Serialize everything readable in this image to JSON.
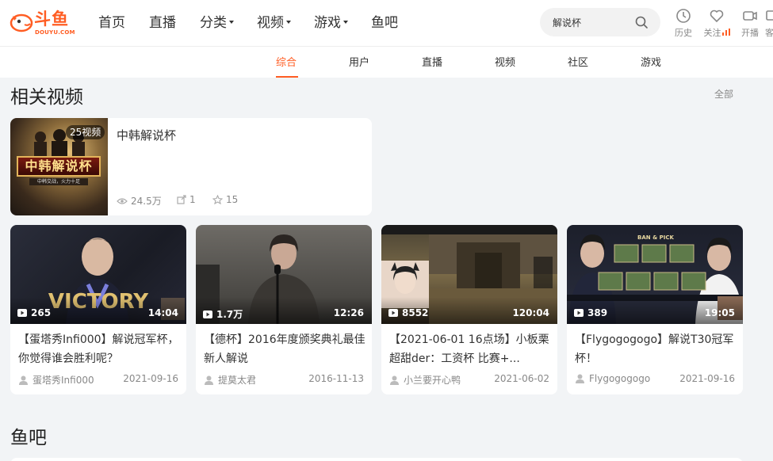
{
  "header": {
    "logo_text": "斗鱼",
    "logo_sub": "DOUYU.COM",
    "nav": [
      {
        "label": "首页",
        "dropdown": false
      },
      {
        "label": "直播",
        "dropdown": false
      },
      {
        "label": "分类",
        "dropdown": true
      },
      {
        "label": "视频",
        "dropdown": true
      },
      {
        "label": "游戏",
        "dropdown": true
      },
      {
        "label": "鱼吧",
        "dropdown": false
      }
    ],
    "search": {
      "value": "解说杯",
      "icon": "search-icon"
    },
    "tools": [
      {
        "label": "历史",
        "icon": "clock-icon"
      },
      {
        "label": "关注",
        "icon": "heart-icon"
      },
      {
        "label": "开播",
        "icon": "camera-icon"
      },
      {
        "label": "客",
        "icon": "client-icon"
      }
    ]
  },
  "tabs": [
    {
      "label": "综合",
      "active": true
    },
    {
      "label": "用户",
      "active": false
    },
    {
      "label": "直播",
      "active": false
    },
    {
      "label": "视频",
      "active": false
    },
    {
      "label": "社区",
      "active": false
    },
    {
      "label": "游戏",
      "active": false
    }
  ],
  "related": {
    "title": "相关视频",
    "all_label": "全部",
    "collection": {
      "badge": "25视频",
      "title": "中韩解说杯",
      "thumb_text": "中韩解说杯",
      "thumb_sub": "中韩交战，火力十足",
      "views": "24.5万",
      "shares": "1",
      "favorites": "15"
    },
    "videos": [
      {
        "plays": "265",
        "duration": "14:04",
        "title": "【蛋塔秀Infi000】解说冠军杯，你觉得谁会胜利呢？",
        "author": "蛋塔秀Infi000",
        "date": "2021-09-16",
        "thumb_text": "VICTORY"
      },
      {
        "plays": "1.7万",
        "duration": "12:26",
        "title": "【德杯】2016年度颁奖典礼最佳新人解说",
        "author": "提莫太君",
        "date": "2016-11-13"
      },
      {
        "plays": "8552",
        "duration": "120:04",
        "title": "【2021-06-01 16点场】小板栗超甜der：工资杯 比赛+...",
        "author": "小兰要开心鸭",
        "date": "2021-06-02"
      },
      {
        "plays": "389",
        "duration": "19:05",
        "title": "【Flygogogogo】解说T30冠军杯！",
        "author": "Flygogogogo",
        "date": "2021-09-16",
        "thumb_text": "BAN & PICK"
      }
    ]
  },
  "yuba": {
    "title": "鱼吧"
  },
  "colors": {
    "accent": "#ff5d23",
    "background": "#f2f4f6"
  }
}
